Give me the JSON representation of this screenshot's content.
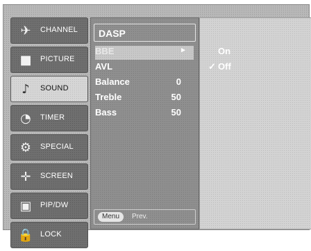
{
  "tabs": [
    {
      "label": "CHANNEL",
      "icon": "channel-icon",
      "glyph": "✈",
      "active": false
    },
    {
      "label": "PICTURE",
      "icon": "picture-icon",
      "glyph": "■",
      "active": false
    },
    {
      "label": "SOUND",
      "icon": "sound-icon",
      "glyph": "♪",
      "active": true
    },
    {
      "label": "TIMER",
      "icon": "timer-icon",
      "glyph": "◔",
      "active": false
    },
    {
      "label": "SPECIAL",
      "icon": "special-icon",
      "glyph": "⚙",
      "active": false
    },
    {
      "label": "SCREEN",
      "icon": "screen-icon",
      "glyph": "✛",
      "active": false
    },
    {
      "label": "PIP/DW",
      "icon": "pip-icon",
      "glyph": "▣",
      "active": false
    },
    {
      "label": "LOCK",
      "icon": "lock-icon",
      "glyph": "🔒",
      "active": false
    }
  ],
  "sound_menu": {
    "header": "DASP",
    "items": [
      {
        "label": "BBE",
        "value": "",
        "selected": true,
        "has_submenu": true
      },
      {
        "label": "AVL",
        "value": ""
      },
      {
        "label": "Balance",
        "value": "0"
      },
      {
        "label": "Treble",
        "value": "50"
      },
      {
        "label": "Bass",
        "value": "50"
      }
    ],
    "arrow": "►",
    "footer": {
      "menu_label": "Menu",
      "prev_label": "Prev."
    }
  },
  "submenu": {
    "options": [
      {
        "label": "On",
        "checked": false,
        "check_glyph": ""
      },
      {
        "label": "Off",
        "checked": true,
        "check_glyph": "✓"
      }
    ]
  },
  "colors": {
    "panel": "#8f8f8f",
    "screen": "#b8b8b8",
    "active_tab": "#d6d6d6"
  }
}
